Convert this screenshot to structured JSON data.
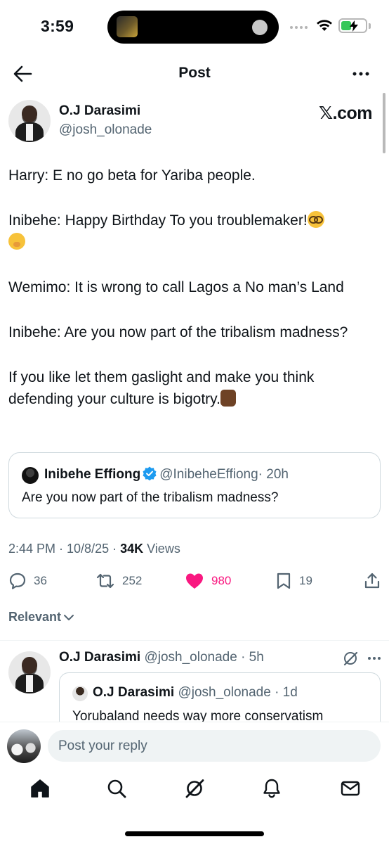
{
  "status_bar": {
    "time": "3:59",
    "icons": [
      "signal-icon",
      "wifi-icon",
      "battery-charging-icon"
    ]
  },
  "header": {
    "title": "Post",
    "back_icon": "arrow-left-icon",
    "more_icon": "more-horizontal-icon"
  },
  "post": {
    "author_name": "O.J Darasimi",
    "author_handle": "@josh_olonade",
    "badge_text": "𝕏.com",
    "paragraphs": [
      "Harry: E no go beta for Yariba people.",
      "Inibehe: Happy Birthday To you troublemaker!",
      "Wemimo: It is wrong to call Lagos a No man’s Land",
      "Inibehe: Are you now part of the tribalism madness?",
      "If you like let them gaslight and make you think defending your culture is bigotry."
    ],
    "emojis": [
      "nerd-face-emoji",
      "hand-over-mouth-emoji",
      "thumbs-up-dark-skin-emoji"
    ],
    "quote": {
      "name": "Inibehe Effiong",
      "verified": true,
      "verified_color": "#1d9bf0",
      "handle": "@InibeheEffiong",
      "age": "· 20h",
      "text": "Are you now part of the tribalism madness?"
    },
    "time": "2:44 PM · 10/8/25 · ",
    "views_count": "34K",
    "views_label": " Views",
    "stats": {
      "replies": "36",
      "reposts": "252",
      "likes": "980",
      "bookmarks": "19"
    },
    "liked": true,
    "like_color": "#f91880"
  },
  "sort": {
    "label": "Relevant"
  },
  "reply": {
    "author_name": "O.J Darasimi",
    "meta": "@josh_olonade · 5h",
    "quote": {
      "name": "O.J Darasimi",
      "meta": "@josh_olonade · 1d",
      "text": "Yorubaland needs way more conservatism"
    }
  },
  "composer": {
    "placeholder": "Post your reply"
  },
  "tabbar": {
    "items": [
      "home-icon",
      "search-icon",
      "grok-icon",
      "notifications-icon",
      "messages-icon"
    ]
  },
  "colors": {
    "text": "#0f1419",
    "secondary": "#536471",
    "border": "#cfd9de"
  }
}
